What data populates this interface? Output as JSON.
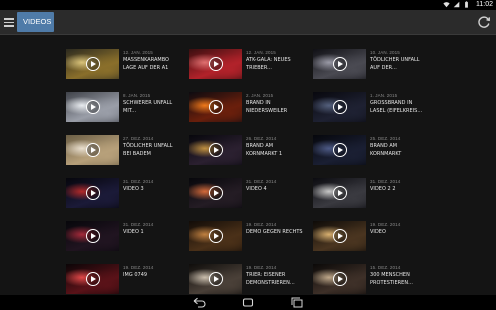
{
  "status": {
    "time": "11:02",
    "icons": [
      "wifi-icon",
      "signal-icon",
      "battery-icon"
    ]
  },
  "actionbar": {
    "tab_label": "VIDEOS",
    "accent": "#4f7ba8"
  },
  "videos": [
    {
      "date": "12. JAN. 2015",
      "title": "MASSENKARAMBO LAGE AUF DER A1",
      "palette": [
        "#2c2a1f",
        "#8a6f2b",
        "#d9c37a"
      ]
    },
    {
      "date": "12. JAN. 2015",
      "title": "ATK-GALA: NEUES TRIEBER...",
      "palette": [
        "#3a0f10",
        "#b2222a",
        "#e07070"
      ]
    },
    {
      "date": "10. JAN. 2015",
      "title": "TÖDLICHER UNFALL AUF DER...",
      "palette": [
        "#101015",
        "#4a4a52",
        "#9a9aa6"
      ]
    },
    {
      "date": "8. JAN. 2015",
      "title": "SCHWERER UNFALL MIT...",
      "palette": [
        "#3f4249",
        "#9a9ea8",
        "#e8ebef"
      ]
    },
    {
      "date": "2. JAN. 2015",
      "title": "BRAND IN NIEDERSWEILER",
      "palette": [
        "#0d0b10",
        "#6a1f0c",
        "#f07a1a"
      ]
    },
    {
      "date": "1. JAN. 2015",
      "title": "GROSSBRAND IN LASEL (EIFELKREIS...",
      "palette": [
        "#08080e",
        "#1e2132",
        "#54607d"
      ]
    },
    {
      "date": "27. DEZ. 2014",
      "title": "TÖDLICHER UNFALL BEI BADEM",
      "palette": [
        "#6b5e45",
        "#b7a07a",
        "#e9dfcf"
      ]
    },
    {
      "date": "26. DEZ. 2014",
      "title": "BRAND AM KORNMARKT 1",
      "palette": [
        "#07070c",
        "#2b2030",
        "#c09040"
      ]
    },
    {
      "date": "25. DEZ. 2014",
      "title": "BRAND AM KORNMARKT",
      "palette": [
        "#06070c",
        "#1a1f33",
        "#4d5a86"
      ]
    },
    {
      "date": "31. DEZ. 2014",
      "title": "VIDEO 3",
      "palette": [
        "#06060c",
        "#1b1a38",
        "#b32a2a"
      ]
    },
    {
      "date": "31. DEZ. 2014",
      "title": "VIDEO 4",
      "palette": [
        "#07070b",
        "#241c24",
        "#d46a3a"
      ]
    },
    {
      "date": "31. DEZ. 2014",
      "title": "VIDEO 2 2",
      "palette": [
        "#0b0b10",
        "#3a3a40",
        "#c8c8c8"
      ]
    },
    {
      "date": "31. DEZ. 2014",
      "title": "VIDEO 1",
      "palette": [
        "#07070b",
        "#201420",
        "#a52a3a"
      ]
    },
    {
      "date": "19. DEZ. 2014",
      "title": "DEMO GEGEN RECHTS",
      "palette": [
        "#120c08",
        "#4a3018",
        "#c08040"
      ]
    },
    {
      "date": "19. DEZ. 2014",
      "title": "VIDEO",
      "palette": [
        "#0e0b08",
        "#4a3520",
        "#d8b070"
      ]
    },
    {
      "date": "19. DEZ. 2014",
      "title": "IMG 0749",
      "palette": [
        "#0b0507",
        "#5a1218",
        "#e04848"
      ]
    },
    {
      "date": "19. DEZ. 2014",
      "title": "TRIER: EISENER DEMONSTRIEREN...",
      "palette": [
        "#0f0d0b",
        "#4a4038",
        "#cbbfae"
      ]
    },
    {
      "date": "15. DEZ. 2014",
      "title": "300 MENSCHEN PROTESTIEREN...",
      "palette": [
        "#0b0908",
        "#3e3028",
        "#bfa88a"
      ]
    }
  ]
}
